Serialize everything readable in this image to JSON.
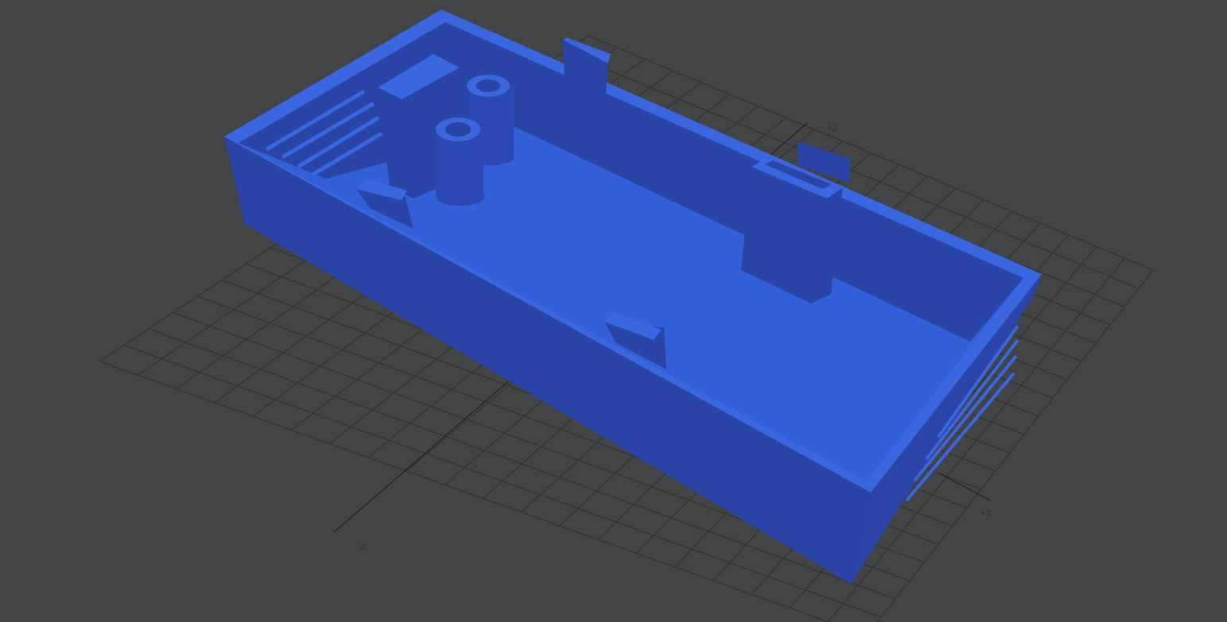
{
  "viewer": {
    "axis_labels": {
      "pos_z": "+Z",
      "neg_z": "-Z",
      "pos_x": "+X"
    },
    "colors": {
      "background": "#434445",
      "grid": "#2e2f30",
      "model_wall": "#2a44a8",
      "model_floor": "#3360d8",
      "model_top": "#3a66e0"
    }
  }
}
